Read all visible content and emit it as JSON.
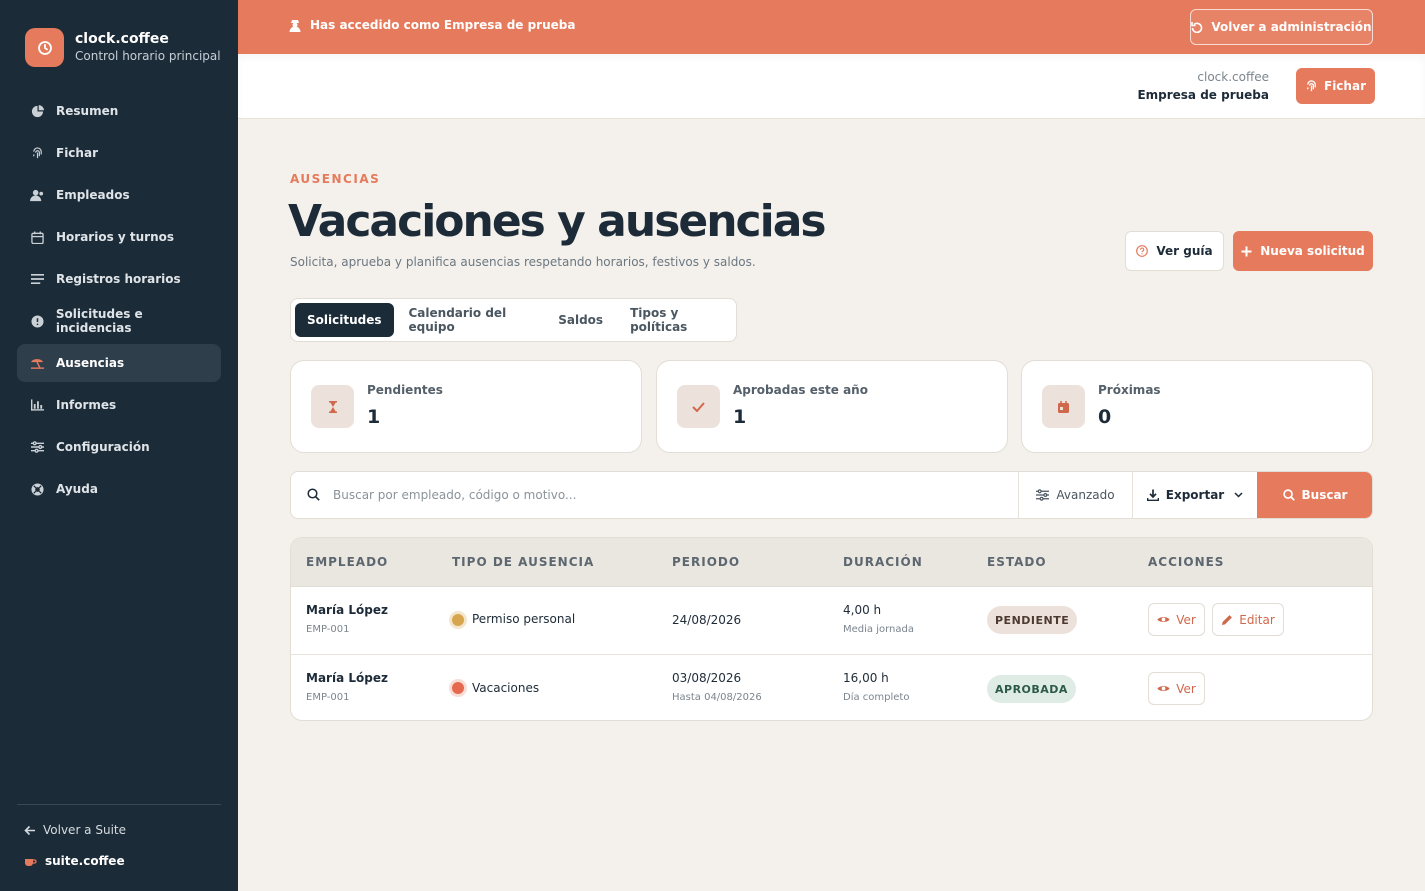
{
  "brand": {
    "name": "clock.coffee",
    "subtitle": "Control horario principal"
  },
  "nav": [
    {
      "label": "Resumen",
      "icon": "pie-chart-icon"
    },
    {
      "label": "Fichar",
      "icon": "fingerprint-icon"
    },
    {
      "label": "Empleados",
      "icon": "users-icon"
    },
    {
      "label": "Horarios y turnos",
      "icon": "calendar-icon"
    },
    {
      "label": "Registros horarios",
      "icon": "list-icon"
    },
    {
      "label": "Solicitudes e incidencias",
      "icon": "alert-circle-icon"
    },
    {
      "label": "Ausencias",
      "icon": "umbrella-beach-icon",
      "active": true
    },
    {
      "label": "Informes",
      "icon": "bar-chart-icon"
    },
    {
      "label": "Configuración",
      "icon": "sliders-icon"
    },
    {
      "label": "Ayuda",
      "icon": "lifebuoy-icon"
    }
  ],
  "sidebar_footer": {
    "back_label": "Volver a Suite",
    "suite_name": "suite.coffee"
  },
  "banner": {
    "text": "Has accedido como Empresa de prueba",
    "back_admin": "Volver a administración"
  },
  "topbar": {
    "company_domain": "clock.coffee",
    "company_name": "Empresa de prueba",
    "fichar_label": "Fichar"
  },
  "page": {
    "eyebrow": "AUSENCIAS",
    "title": "Vacaciones y ausencias",
    "subtitle": "Solicita, aprueba y planifica ausencias respetando horarios, festivos y saldos.",
    "guide_label": "Ver guía",
    "new_label": "Nueva solicitud"
  },
  "tabs": [
    {
      "label": "Solicitudes",
      "active": true
    },
    {
      "label": "Calendario del equipo"
    },
    {
      "label": "Saldos"
    },
    {
      "label": "Tipos y políticas"
    }
  ],
  "stats": [
    {
      "label": "Pendientes",
      "value": "1",
      "icon": "hourglass-icon"
    },
    {
      "label": "Aprobadas este año",
      "value": "1",
      "icon": "check-icon"
    },
    {
      "label": "Próximas",
      "value": "0",
      "icon": "calendar-icon"
    }
  ],
  "search": {
    "placeholder": "Buscar por empleado, código o motivo...",
    "value": "",
    "advanced_label": "Avanzado",
    "export_label": "Exportar",
    "search_label": "Buscar"
  },
  "table": {
    "headers": [
      "EMPLEADO",
      "TIPO DE AUSENCIA",
      "PERIODO",
      "DURACIÓN",
      "ESTADO",
      "ACCIONES"
    ],
    "rows": [
      {
        "employee": "María López",
        "code": "EMP-001",
        "type": "Permiso personal",
        "type_color": "#d8a54f",
        "period": "24/08/2026",
        "period_sub": "",
        "duration": "4,00 h",
        "duration_sub": "Media jornada",
        "status": "PENDIENTE",
        "actions": [
          "Ver",
          "Editar"
        ]
      },
      {
        "employee": "María López",
        "code": "EMP-001",
        "type": "Vacaciones",
        "type_color": "#e5684f",
        "period": "03/08/2026",
        "period_sub": "Hasta 04/08/2026",
        "duration": "16,00 h",
        "duration_sub": "Día completo",
        "status": "APROBADA",
        "actions": [
          "Ver"
        ]
      }
    ]
  },
  "colors": {
    "accent": "#e57a5c",
    "sidebar": "#1c2b38",
    "background": "#f4f1ec"
  }
}
